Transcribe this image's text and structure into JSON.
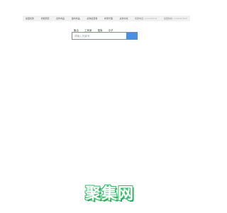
{
  "nav": {
    "items": [
      "加盟优势",
      "智能研究",
      "合作商品",
      "备料商品",
      "采购运营者",
      "商家代理",
      "采供方案"
    ],
    "hint1": {
      "label": "客服电话:",
      "value": "012345678"
    },
    "hint2": {
      "label": "加盟热线:",
      "value": "1234567890"
    }
  },
  "search": {
    "tabs": [
      "聚合",
      "工商家",
      "搜索",
      "中子"
    ],
    "placeholder": "请输入关键词",
    "button_color": "#4a90e2",
    "border_color": "#5d93d8"
  },
  "footer": {
    "logo_text": "聚集网",
    "logo_color": "#35c46a"
  }
}
